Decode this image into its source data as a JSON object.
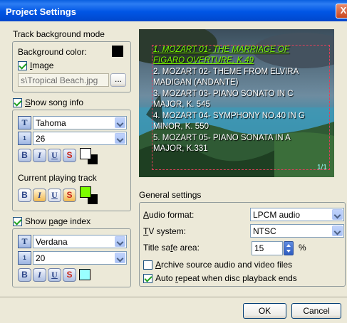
{
  "window": {
    "title": "Project Settings",
    "close_label": "X"
  },
  "track_background": {
    "group_label": "Track background mode",
    "background_color_label": "Background color:",
    "background_color": "#000000",
    "image_label": "Image",
    "image_checked": true,
    "image_path": "s\\Tropical Beach.jpg",
    "browse_label": "..."
  },
  "song_info": {
    "show_label": "Show song info",
    "checked": true,
    "font": "Tahoma",
    "size": "26",
    "style_buttons": [
      "B",
      "I",
      "U",
      "S"
    ],
    "text_color": "#FFFFFF",
    "shadow_color": "#000000",
    "current_track_label": "Current playing track",
    "current_color": "#7CFC00",
    "current_shadow_color": "#000000"
  },
  "page_index": {
    "show_label": "Show page index",
    "checked": true,
    "font": "Verdana",
    "size": "20",
    "style_buttons": [
      "B",
      "I",
      "U",
      "S"
    ],
    "color": "#99FFFF"
  },
  "preview": {
    "tracks": [
      "1. MOZART 01- THE MARRIAGE OF FIGARO OVERTURE, K.49",
      "2. MOZART 02- THEME FROM ELVIRA MADIGAN (ANDANTE)",
      "3. MOZART 03- PIANO SONATO IN C MAJOR, K. 545",
      "4. MOZART 04- SYMPHONY NO.40 IN G MINOR, K. 550",
      "5. MOZART 05- PIANO SONATA IN A MAJOR, K.331"
    ],
    "page_index": "1/1",
    "highlight_color": "#7CFC00",
    "frame_color": "#E0405A"
  },
  "general": {
    "section_label": "General settings",
    "audio_format_label": "Audio format:",
    "audio_format": "LPCM audio",
    "tv_system_label": "TV system:",
    "tv_system": "NTSC",
    "title_safe_label": "Title safe area:",
    "title_safe_value": "15",
    "title_safe_unit": "%",
    "archive_label": "Archive source audio and video files",
    "archive_checked": false,
    "auto_repeat_label": "Auto repeat when disc playback ends",
    "auto_repeat_checked": true
  },
  "footer": {
    "ok_label": "OK",
    "cancel_label": "Cancel"
  }
}
